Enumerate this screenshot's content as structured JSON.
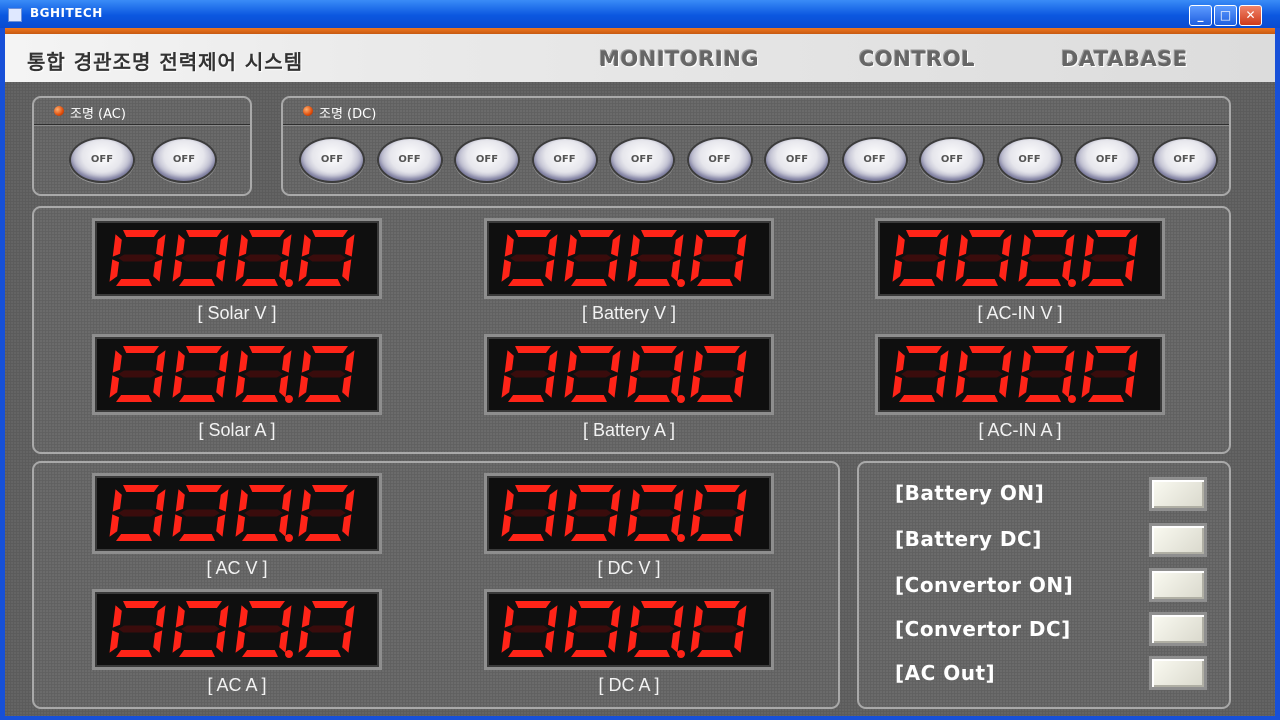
{
  "window": {
    "title": "BGHITECH",
    "minimize_icon": "minimize-icon",
    "maximize_icon": "maximize-icon",
    "close_icon": "close-icon"
  },
  "header": {
    "app_title": "통합 경관조명 전력제어 시스템",
    "nav": [
      "MONITORING",
      "CONTROL",
      "DATABASE"
    ]
  },
  "ac_panel": {
    "title": "조명 (AC)",
    "button_label": "OFF",
    "button_count": 2
  },
  "dc_panel": {
    "title": "조명 (DC)",
    "button_label": "OFF",
    "button_count": 12
  },
  "meters": {
    "solar_v": {
      "value": "000.0",
      "label": "[ Solar V ]"
    },
    "battery_v": {
      "value": "000.0",
      "label": "[ Battery V ]"
    },
    "acin_v": {
      "value": "000.0",
      "label": "[ AC-IN V ]"
    },
    "solar_a": {
      "value": "000.0",
      "label": "[ Solar A ]"
    },
    "battery_a": {
      "value": "000.0",
      "label": "[ Battery A ]"
    },
    "acin_a": {
      "value": "000.0",
      "label": "[ AC-IN A ]"
    },
    "ac_v": {
      "value": "000.0",
      "label": "[ AC  V ]"
    },
    "dc_v": {
      "value": "000.0",
      "label": "[ DC  V ]"
    },
    "ac_a": {
      "value": "000.0",
      "label": "[ AC  A ]"
    },
    "dc_a": {
      "value": "000.0",
      "label": "[ DC  A ]"
    }
  },
  "status": {
    "battery_on": "[Battery ON]",
    "battery_dc": "[Battery DC]",
    "convertor_on": "[Convertor ON]",
    "convertor_dc": "[Convertor DC]",
    "ac_out": "[AC Out]"
  },
  "colors": {
    "segment_on": "#ff2418",
    "segment_off": "#3a0c0c",
    "accent": "#f0781e"
  }
}
